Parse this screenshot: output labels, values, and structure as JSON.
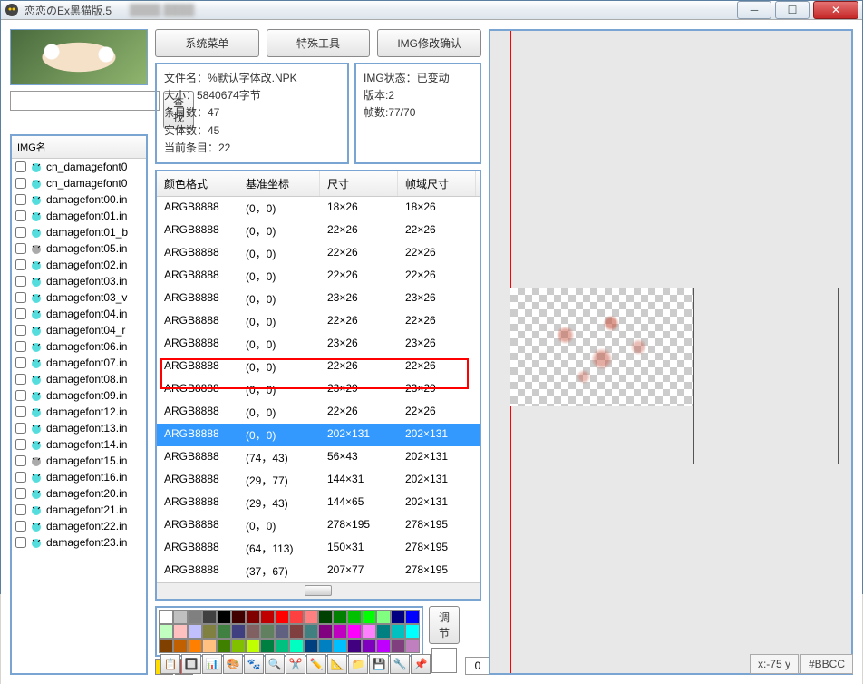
{
  "titlebar": {
    "title": "恋恋のEx黑猫版.5"
  },
  "buttons": {
    "search": "查找",
    "sysmenu": "系统菜单",
    "special": "特殊工具",
    "imgconfirm": "IMG修改确认",
    "adjust": "调节"
  },
  "imglist": {
    "header": "IMG名",
    "items": [
      {
        "n": "cn_damagefont0",
        "c": "cyan"
      },
      {
        "n": "cn_damagefont0",
        "c": "cyan"
      },
      {
        "n": "damagefont00.in",
        "c": "cyan"
      },
      {
        "n": "damagefont01.in",
        "c": "cyan"
      },
      {
        "n": "damagefont01_b",
        "c": "cyan"
      },
      {
        "n": "damagefont05.in",
        "c": "gray"
      },
      {
        "n": "damagefont02.in",
        "c": "cyan"
      },
      {
        "n": "damagefont03.in",
        "c": "cyan"
      },
      {
        "n": "damagefont03_v",
        "c": "cyan"
      },
      {
        "n": "damagefont04.in",
        "c": "cyan"
      },
      {
        "n": "damagefont04_r",
        "c": "cyan"
      },
      {
        "n": "damagefont06.in",
        "c": "cyan"
      },
      {
        "n": "damagefont07.in",
        "c": "cyan"
      },
      {
        "n": "damagefont08.in",
        "c": "cyan"
      },
      {
        "n": "damagefont09.in",
        "c": "cyan"
      },
      {
        "n": "damagefont12.in",
        "c": "cyan"
      },
      {
        "n": "damagefont13.in",
        "c": "cyan"
      },
      {
        "n": "damagefont14.in",
        "c": "cyan"
      },
      {
        "n": "damagefont15.in",
        "c": "gray"
      },
      {
        "n": "damagefont16.in",
        "c": "cyan"
      },
      {
        "n": "damagefont20.in",
        "c": "cyan"
      },
      {
        "n": "damagefont21.in",
        "c": "cyan"
      },
      {
        "n": "damagefont22.in",
        "c": "cyan"
      },
      {
        "n": "damagefont23.in",
        "c": "cyan"
      }
    ]
  },
  "info": {
    "line1": "文件名：%默认字体改.NPK",
    "line2": "大小：5840674字节",
    "line3": "条目数：47",
    "line4": "实体数：45",
    "line5": "当前条目：22",
    "r1": "IMG状态：已变动",
    "r2": "版本:2",
    "r3": "帧数:77/70"
  },
  "grid": {
    "headers": [
      "颜色格式",
      "基准坐标",
      "尺寸",
      "帧域尺寸"
    ],
    "rows": [
      [
        "ARGB8888",
        "(0，0)",
        "18×26",
        "18×26"
      ],
      [
        "ARGB8888",
        "(0，0)",
        "22×26",
        "22×26"
      ],
      [
        "ARGB8888",
        "(0，0)",
        "22×26",
        "22×26"
      ],
      [
        "ARGB8888",
        "(0，0)",
        "22×26",
        "22×26"
      ],
      [
        "ARGB8888",
        "(0，0)",
        "23×26",
        "23×26"
      ],
      [
        "ARGB8888",
        "(0，0)",
        "22×26",
        "22×26"
      ],
      [
        "ARGB8888",
        "(0，0)",
        "23×26",
        "23×26"
      ],
      [
        "ARGB8888",
        "(0，0)",
        "22×26",
        "22×26"
      ],
      [
        "ARGB8888",
        "(0，0)",
        "23×29",
        "23×29"
      ],
      [
        "ARGB8888",
        "(0，0)",
        "22×26",
        "22×26"
      ],
      [
        "ARGB8888",
        "(0，0)",
        "202×131",
        "202×131"
      ],
      [
        "ARGB8888",
        "(74，43)",
        "56×43",
        "202×131"
      ],
      [
        "ARGB8888",
        "(29，77)",
        "144×31",
        "202×131"
      ],
      [
        "ARGB8888",
        "(29，43)",
        "144×65",
        "202×131"
      ],
      [
        "ARGB8888",
        "(0，0)",
        "278×195",
        "278×195"
      ],
      [
        "ARGB8888",
        "(64，113)",
        "150×31",
        "278×195"
      ],
      [
        "ARGB8888",
        "(37，67)",
        "207×77",
        "278×195"
      ]
    ],
    "selected": 10
  },
  "palette": [
    [
      "#ffffff",
      "#c0c0c0",
      "#808080",
      "#404040",
      "#000000",
      "#400000",
      "#800000",
      "#c00000",
      "#ff0000",
      "#ff4040",
      "#ff8080",
      "#004000",
      "#008000",
      "#00c000",
      "#00ff00",
      "#80ff80",
      "#000080",
      "#0000ff"
    ],
    [
      "#c0ffc0",
      "#ffc0c0",
      "#c0c0ff",
      "#808040",
      "#408040",
      "#404080",
      "#806060",
      "#608060",
      "#606080",
      "#804040",
      "#408080",
      "#800080",
      "#c000c0",
      "#ff00ff",
      "#ff80ff",
      "#008080",
      "#00c0c0",
      "#00ffff"
    ],
    [
      "#804000",
      "#c06000",
      "#ff8000",
      "#ffc080",
      "#408000",
      "#80c000",
      "#c0ff00",
      "#008040",
      "#00c080",
      "#00ffc0",
      "#004080",
      "#0080c0",
      "#00c0ff",
      "#400080",
      "#8000c0",
      "#c000ff",
      "#804080",
      "#c080c0"
    ]
  ],
  "spinner": {
    "value": "0"
  },
  "status": {
    "coords": "x:-75 y",
    "color": "#BBCC"
  },
  "toolicons": [
    "📋",
    "🔲",
    "📊",
    "🎨",
    "🐾",
    "🔍",
    "✂️",
    "✏️",
    "📐",
    "📁",
    "💾",
    "🔧",
    "📌"
  ]
}
